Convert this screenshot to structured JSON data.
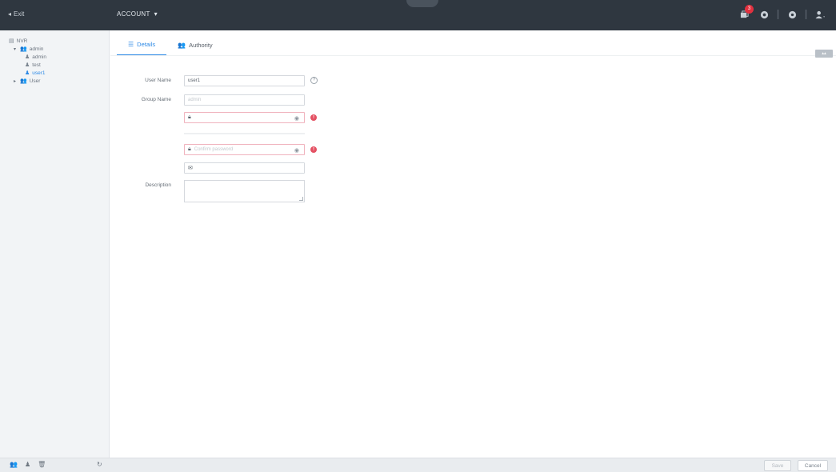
{
  "topbar": {
    "exit_label": "Exit",
    "module_label": "ACCOUNT",
    "alarm_count": "3"
  },
  "sidebar": {
    "root": "NVR",
    "group_admin": "admin",
    "user_admin": "admin",
    "user_test": "test",
    "user_user1": "user1",
    "group_user": "User"
  },
  "tabs": {
    "details": "Details",
    "authority": "Authority"
  },
  "form": {
    "username_label": "User Name",
    "username_value": "user1",
    "group_label": "Group Name",
    "group_placeholder": "admin",
    "password_placeholder": "",
    "confirm_placeholder": "Confirm password",
    "email_value": "",
    "description_label": "Description"
  },
  "footer": {
    "save_label": "Save",
    "cancel_label": "Cancel"
  },
  "colors": {
    "accent": "#2e8ae6",
    "topbar": "#2f3740",
    "warning": "#e45062"
  }
}
